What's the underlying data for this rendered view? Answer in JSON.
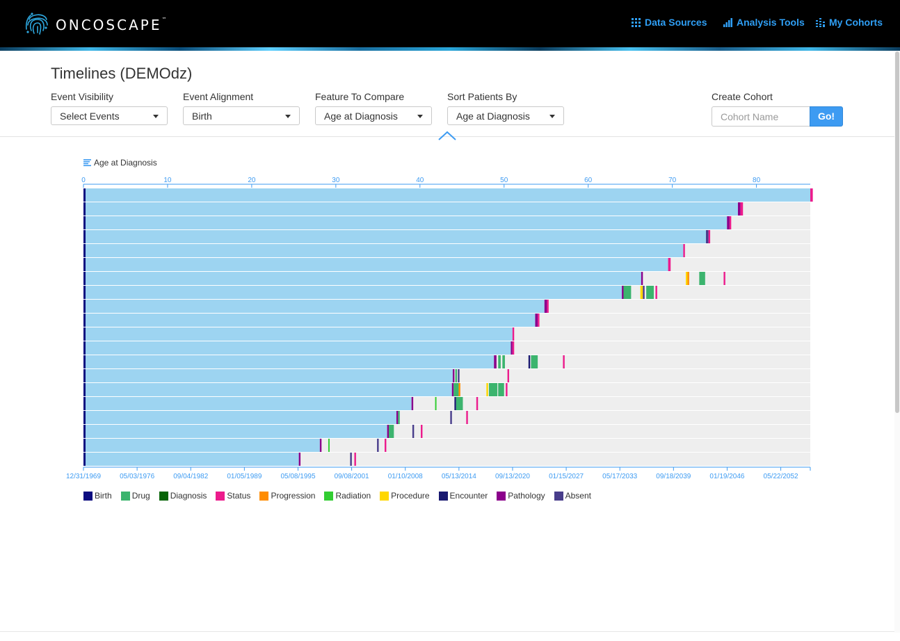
{
  "app": {
    "brand": "ONCOSCAPE",
    "tm": "™",
    "nav": [
      {
        "label": "Data Sources",
        "icon": "grid-icon"
      },
      {
        "label": "Analysis Tools",
        "icon": "bar-chart-icon"
      },
      {
        "label": "My Cohorts",
        "icon": "list-bars-icon"
      }
    ]
  },
  "page": {
    "title": "Timelines (DEMOdz)",
    "controls": {
      "event_visibility": {
        "label": "Event Visibility",
        "value": "Select Events"
      },
      "event_alignment": {
        "label": "Event Alignment",
        "value": "Birth"
      },
      "feature_compare": {
        "label": "Feature To Compare",
        "value": "Age at Diagnosis"
      },
      "sort_by": {
        "label": "Sort Patients By",
        "value": "Age at Diagnosis"
      },
      "create_cohort": {
        "label": "Create Cohort",
        "placeholder": "Cohort Name",
        "button": "Go!"
      }
    }
  },
  "colors": {
    "feature_bar": "#9dd4f1",
    "track": "#eeeeee",
    "axis": "#3d9bf2",
    "Birth": "#0c0c80",
    "Drug": "#3cb46e",
    "Diagnosis": "#066406",
    "Status": "#ec1b8c",
    "Progression": "#ff8c00",
    "Radiation": "#32cd32",
    "Procedure": "#ffd700",
    "Encounter": "#191970",
    "Pathology": "#8b008b",
    "Absent": "#483d8b"
  },
  "chart_data": {
    "type": "timeline",
    "feature_label": "Age at Diagnosis",
    "top_axis": {
      "ticks": [
        0,
        10,
        20,
        30,
        40,
        50,
        60,
        70,
        80
      ],
      "domain": [
        0,
        86.4
      ]
    },
    "bottom_axis": {
      "ticks": [
        "12/31/1969",
        "05/03/1976",
        "09/04/1982",
        "01/05/1989",
        "05/08/1995",
        "09/08/2001",
        "01/10/2008",
        "05/13/2014",
        "09/13/2020",
        "01/15/2027",
        "05/17/2033",
        "09/18/2039",
        "01/19/2046",
        "05/22/2052"
      ]
    },
    "legend": [
      "Birth",
      "Drug",
      "Diagnosis",
      "Status",
      "Progression",
      "Radiation",
      "Procedure",
      "Encounter",
      "Pathology",
      "Absent"
    ],
    "patients": [
      {
        "feature": 86.4,
        "events": [
          {
            "type": "Status",
            "start": 86.4,
            "end": 86.7
          }
        ]
      },
      {
        "feature": 77.8,
        "events": [
          {
            "type": "Pathology",
            "start": 77.8,
            "end": 78.1
          },
          {
            "type": "Status",
            "start": 78.1,
            "end": 78.4
          }
        ]
      },
      {
        "feature": 76.5,
        "events": [
          {
            "type": "Pathology",
            "start": 76.5,
            "end": 76.8
          },
          {
            "type": "Status",
            "start": 76.8,
            "end": 77.0
          }
        ]
      },
      {
        "feature": 74.0,
        "events": [
          {
            "type": "Absent",
            "start": 74.0,
            "end": 74.3
          },
          {
            "type": "Status",
            "start": 74.3,
            "end": 74.5
          }
        ]
      },
      {
        "feature": 71.3,
        "events": [
          {
            "type": "Status",
            "start": 71.3,
            "end": 71.5
          }
        ]
      },
      {
        "feature": 69.5,
        "events": [
          {
            "type": "Status",
            "start": 69.5,
            "end": 69.8
          }
        ]
      },
      {
        "feature": 66.3,
        "events": [
          {
            "type": "Pathology",
            "start": 66.3,
            "end": 66.5
          },
          {
            "type": "Procedure",
            "start": 71.6,
            "end": 71.8
          },
          {
            "type": "Progression",
            "start": 71.8,
            "end": 72.0
          },
          {
            "type": "Drug",
            "start": 73.2,
            "end": 73.9
          },
          {
            "type": "Status",
            "start": 76.1,
            "end": 76.3
          }
        ]
      },
      {
        "feature": 64.0,
        "events": [
          {
            "type": "Pathology",
            "start": 64.0,
            "end": 64.2
          },
          {
            "type": "Drug",
            "start": 64.2,
            "end": 65.1
          },
          {
            "type": "Procedure",
            "start": 66.2,
            "end": 66.5
          },
          {
            "type": "Absent",
            "start": 66.5,
            "end": 66.7
          },
          {
            "type": "Drug",
            "start": 66.9,
            "end": 67.8
          },
          {
            "type": "Status",
            "start": 68.0,
            "end": 68.2
          }
        ]
      },
      {
        "feature": 54.8,
        "events": [
          {
            "type": "Pathology",
            "start": 54.8,
            "end": 55.1
          },
          {
            "type": "Status",
            "start": 55.1,
            "end": 55.3
          }
        ]
      },
      {
        "feature": 53.7,
        "events": [
          {
            "type": "Pathology",
            "start": 53.7,
            "end": 54.0
          },
          {
            "type": "Status",
            "start": 54.0,
            "end": 54.2
          }
        ]
      },
      {
        "feature": 51.0,
        "events": [
          {
            "type": "Status",
            "start": 51.0,
            "end": 51.2
          }
        ]
      },
      {
        "feature": 50.8,
        "events": [
          {
            "type": "Pathology",
            "start": 50.8,
            "end": 51.0
          },
          {
            "type": "Status",
            "start": 51.0,
            "end": 51.2
          }
        ]
      },
      {
        "feature": 48.8,
        "events": [
          {
            "type": "Pathology",
            "start": 48.8,
            "end": 49.1
          },
          {
            "type": "Drug",
            "start": 49.3,
            "end": 49.6
          },
          {
            "type": "Drug",
            "start": 49.8,
            "end": 50.1
          },
          {
            "type": "Encounter",
            "start": 52.9,
            "end": 53.1
          },
          {
            "type": "Drug",
            "start": 53.2,
            "end": 54.0
          },
          {
            "type": "Status",
            "start": 57.0,
            "end": 57.2
          }
        ]
      },
      {
        "feature": 43.9,
        "events": [
          {
            "type": "Pathology",
            "start": 43.9,
            "end": 44.1
          },
          {
            "type": "Drug",
            "start": 44.2,
            "end": 44.4
          },
          {
            "type": "Absent",
            "start": 44.5,
            "end": 44.7
          },
          {
            "type": "Status",
            "start": 50.4,
            "end": 50.6
          }
        ]
      },
      {
        "feature": 43.8,
        "events": [
          {
            "type": "Pathology",
            "start": 43.8,
            "end": 44.0
          },
          {
            "type": "Drug",
            "start": 44.0,
            "end": 44.6
          },
          {
            "type": "Progression",
            "start": 44.6,
            "end": 44.8
          },
          {
            "type": "Procedure",
            "start": 47.9,
            "end": 48.1
          },
          {
            "type": "Drug",
            "start": 48.2,
            "end": 49.2
          },
          {
            "type": "Drug",
            "start": 49.3,
            "end": 50.0
          },
          {
            "type": "Status",
            "start": 50.2,
            "end": 50.4
          }
        ]
      },
      {
        "feature": 39.0,
        "events": [
          {
            "type": "Pathology",
            "start": 39.0,
            "end": 39.2
          },
          {
            "type": "Radiation",
            "start": 41.8,
            "end": 41.9
          },
          {
            "type": "Encounter",
            "start": 44.1,
            "end": 44.3
          },
          {
            "type": "Drug",
            "start": 44.3,
            "end": 45.1
          },
          {
            "type": "Status",
            "start": 46.7,
            "end": 46.9
          }
        ]
      },
      {
        "feature": 37.2,
        "events": [
          {
            "type": "Pathology",
            "start": 37.2,
            "end": 37.4
          },
          {
            "type": "Drug",
            "start": 37.4,
            "end": 37.6
          },
          {
            "type": "Absent",
            "start": 43.6,
            "end": 43.8
          },
          {
            "type": "Status",
            "start": 45.5,
            "end": 45.7
          }
        ]
      },
      {
        "feature": 36.1,
        "events": [
          {
            "type": "Pathology",
            "start": 36.1,
            "end": 36.3
          },
          {
            "type": "Drug",
            "start": 36.3,
            "end": 36.9
          },
          {
            "type": "Absent",
            "start": 39.1,
            "end": 39.3
          },
          {
            "type": "Status",
            "start": 40.1,
            "end": 40.3
          }
        ]
      },
      {
        "feature": 28.1,
        "events": [
          {
            "type": "Pathology",
            "start": 28.1,
            "end": 28.3
          },
          {
            "type": "Radiation",
            "start": 29.1,
            "end": 29.2
          },
          {
            "type": "Absent",
            "start": 34.9,
            "end": 35.1
          },
          {
            "type": "Status",
            "start": 35.8,
            "end": 36.0
          }
        ]
      },
      {
        "feature": 25.6,
        "events": [
          {
            "type": "Pathology",
            "start": 25.6,
            "end": 25.8
          },
          {
            "type": "Absent",
            "start": 31.7,
            "end": 31.9
          },
          {
            "type": "Status",
            "start": 32.2,
            "end": 32.4
          }
        ]
      }
    ]
  }
}
